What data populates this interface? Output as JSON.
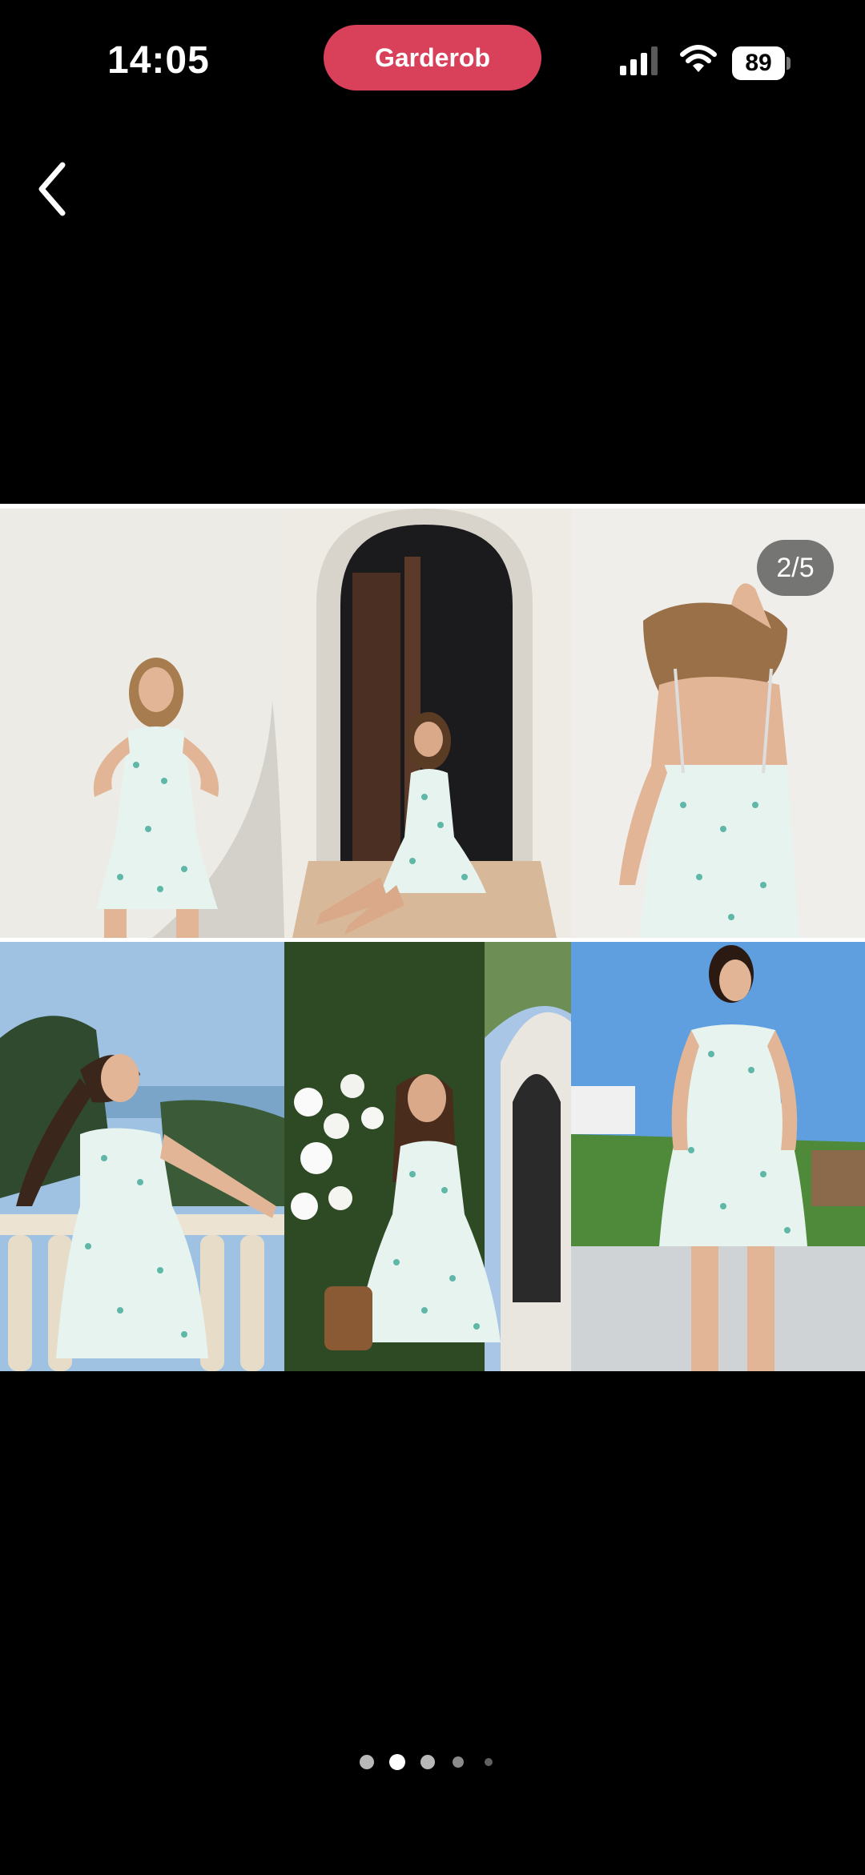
{
  "status_bar": {
    "time": "14:05",
    "app_pill_label": "Garderob",
    "battery_level": "89",
    "signal_icon": "cellular-signal-icon",
    "wifi_icon": "wifi-icon",
    "battery_icon": "battery-icon"
  },
  "nav": {
    "back_icon": "chevron-left-icon"
  },
  "gallery": {
    "counter": "2/5",
    "current_page": 2,
    "total_pages": 5,
    "photos": [
      {
        "scene": "white-wall-standing"
      },
      {
        "scene": "arched-doorway-seated"
      },
      {
        "scene": "back-view-hair"
      },
      {
        "scene": "seaside-balcony"
      },
      {
        "scene": "garden-white-roses"
      },
      {
        "scene": "terrace-blue-sky"
      }
    ]
  },
  "colors": {
    "app_pill": "#d9405a",
    "background": "#000000",
    "dress": "#e6f3ef",
    "dress_pattern": "#5fb7a7",
    "active_dot": "#ffffff",
    "inactive_dot": "#8a8a8a"
  }
}
